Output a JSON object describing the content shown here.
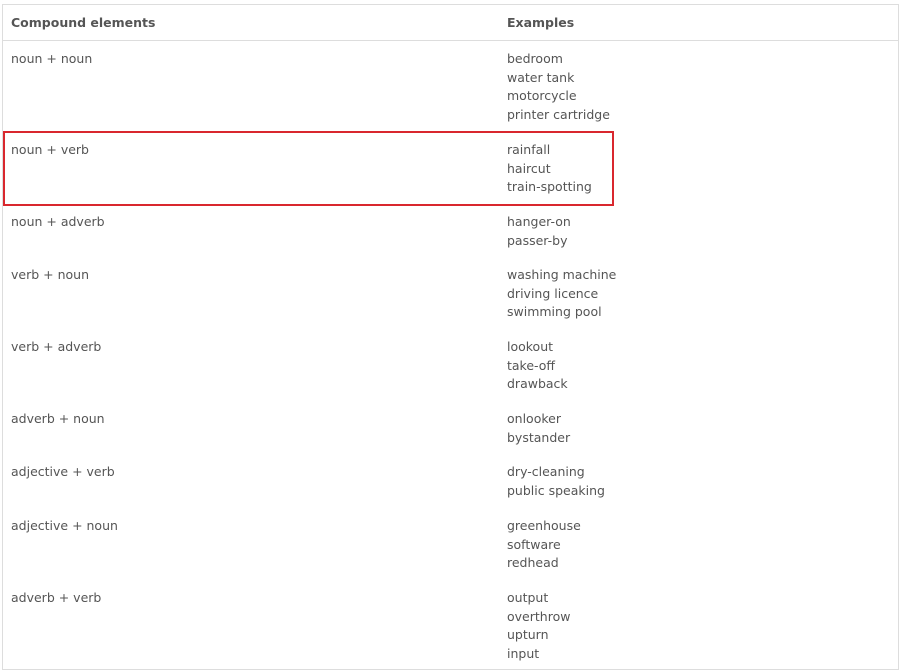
{
  "table": {
    "headers": {
      "compound_elements": "Compound elements",
      "examples": "Examples"
    },
    "rows": [
      {
        "pattern": "noun + noun",
        "examples": [
          "bedroom",
          "water tank",
          "motorcycle",
          "printer cartridge"
        ]
      },
      {
        "pattern": "noun + verb",
        "examples": [
          "rainfall",
          "haircut",
          "train-spotting"
        ]
      },
      {
        "pattern": "noun + adverb",
        "examples": [
          "hanger-on",
          "passer-by"
        ]
      },
      {
        "pattern": "verb + noun",
        "examples": [
          "washing machine",
          "driving licence",
          "swimming pool"
        ]
      },
      {
        "pattern": "verb + adverb",
        "examples": [
          "lookout",
          "take-off",
          "drawback"
        ]
      },
      {
        "pattern": "adverb + noun",
        "examples": [
          "onlooker",
          "bystander"
        ]
      },
      {
        "pattern": "adjective + verb",
        "examples": [
          "dry-cleaning",
          "public speaking"
        ]
      },
      {
        "pattern": "adjective + noun",
        "examples": [
          "greenhouse",
          "software",
          "redhead"
        ]
      },
      {
        "pattern": "adverb + verb",
        "examples": [
          "output",
          "overthrow",
          "upturn",
          "input"
        ]
      }
    ]
  },
  "highlight": {
    "highlighted_row": "noun + verb",
    "color": "#d9272e"
  },
  "colors": {
    "text": "#555555",
    "border": "#dddddd",
    "background": "#ffffff"
  }
}
